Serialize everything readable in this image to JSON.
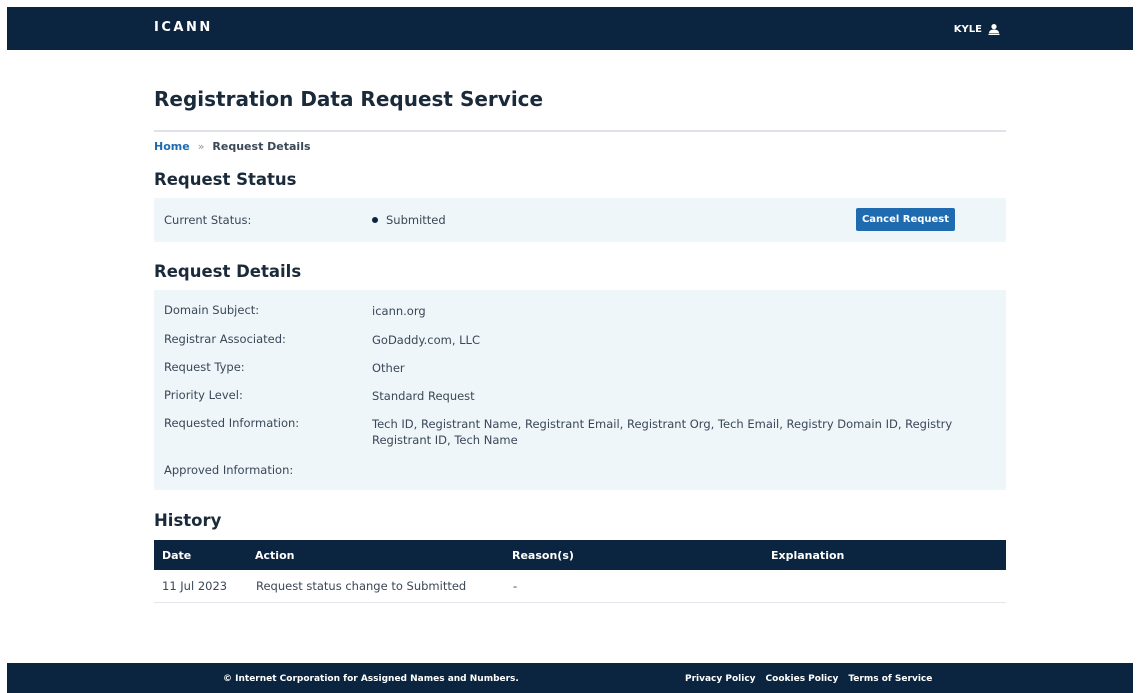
{
  "header": {
    "logo": "ICANN",
    "user_name": "KYLE",
    "user_icon": "user-icon"
  },
  "page": {
    "title": "Registration Data Request Service"
  },
  "breadcrumb": {
    "home": "Home",
    "separator": "»",
    "current": "Request Details"
  },
  "request_status": {
    "heading": "Request Status",
    "label": "Current Status:",
    "value": "Submitted",
    "cancel_label": "Cancel Request"
  },
  "request_details": {
    "heading": "Request Details",
    "rows": [
      {
        "label": "Domain Subject:",
        "value": "icann.org"
      },
      {
        "label": "Registrar Associated:",
        "value": "GoDaddy.com, LLC"
      },
      {
        "label": "Request Type:",
        "value": "Other"
      },
      {
        "label": "Priority Level:",
        "value": "Standard Request"
      },
      {
        "label": "Requested Information:",
        "value": "Tech ID, Registrant Name, Registrant Email, Registrant Org, Tech Email, Registry Domain ID, Registry Registrant ID, Tech Name"
      },
      {
        "label": "Approved Information:",
        "value": ""
      }
    ]
  },
  "history": {
    "heading": "History",
    "columns": [
      "Date",
      "Action",
      "Reason(s)",
      "Explanation"
    ],
    "rows": [
      {
        "date": "11 Jul 2023",
        "action": "Request status change to Submitted",
        "reasons": "-",
        "explanation": ""
      }
    ]
  },
  "footer": {
    "copyright": "© Internet Corporation for Assigned Names and Numbers.",
    "links": [
      "Privacy Policy",
      "Cookies Policy",
      "Terms of Service"
    ]
  },
  "colors": {
    "navy": "#0b2540",
    "accent_blue": "#1e6bb0",
    "panel_bg": "#eef6fa"
  }
}
